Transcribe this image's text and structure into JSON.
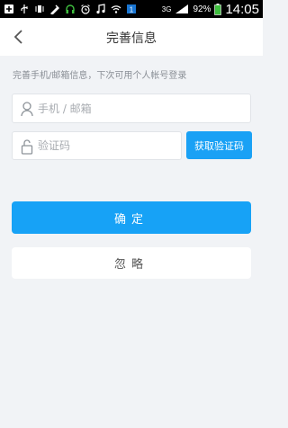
{
  "status_bar": {
    "battery_percent": "92%",
    "network": "3G",
    "time": "14:05",
    "icons": [
      "add-box-icon",
      "usb-icon",
      "vibrate-icon",
      "puzzle-icon",
      "headset-icon",
      "alarm-icon",
      "music-icon",
      "wifi-icon",
      "sim1-icon",
      "signal-icon",
      "battery-icon"
    ]
  },
  "header": {
    "title": "完善信息"
  },
  "form": {
    "hint": "完善手机/邮箱信息，下次可用个人帐号登录",
    "account_placeholder": "手机 / 邮箱",
    "code_placeholder": "验证码",
    "get_code_label": "获取验证码",
    "confirm_label": "确定",
    "ignore_label": "忽略"
  },
  "colors": {
    "accent": "#1aa1f5",
    "background": "#f1f3f6"
  }
}
